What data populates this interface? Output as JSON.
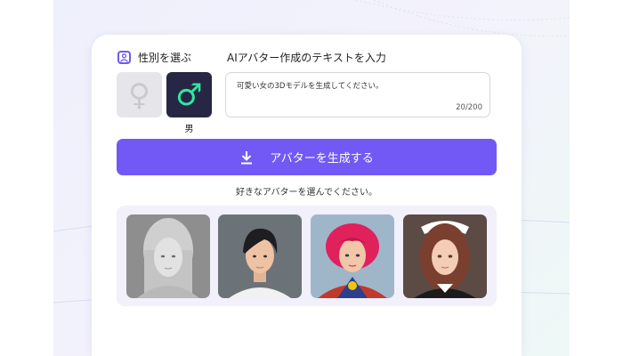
{
  "gender": {
    "title": "性別を選ぶ",
    "selected_label": "男",
    "options": [
      {
        "symbol": "♀",
        "icon": "female-symbol-icon"
      },
      {
        "symbol": "♂",
        "icon": "male-symbol-icon"
      }
    ],
    "selected": "male"
  },
  "prompt": {
    "label": "AIアバター作成のテキストを入力",
    "value": "可愛い女の3Dモデルを生成してください。",
    "counter": "20/200"
  },
  "generate_button": {
    "label": "アバターを生成する",
    "icon": "download-icon"
  },
  "hint": "好きなアバターを選んでください。",
  "gallery": [
    {
      "name": "avatar-grey-woman",
      "style": "grayscale 3D woman"
    },
    {
      "name": "avatar-young-man",
      "style": "3D young man"
    },
    {
      "name": "avatar-superhero-woman",
      "style": "3D superhero woman"
    },
    {
      "name": "avatar-maid-woman",
      "style": "3D maid woman"
    }
  ],
  "colors": {
    "accent": "#7259f6",
    "male_tile": "#272745",
    "male_symbol": "#2ee8a0",
    "female_tile": "#e6e6ea"
  }
}
